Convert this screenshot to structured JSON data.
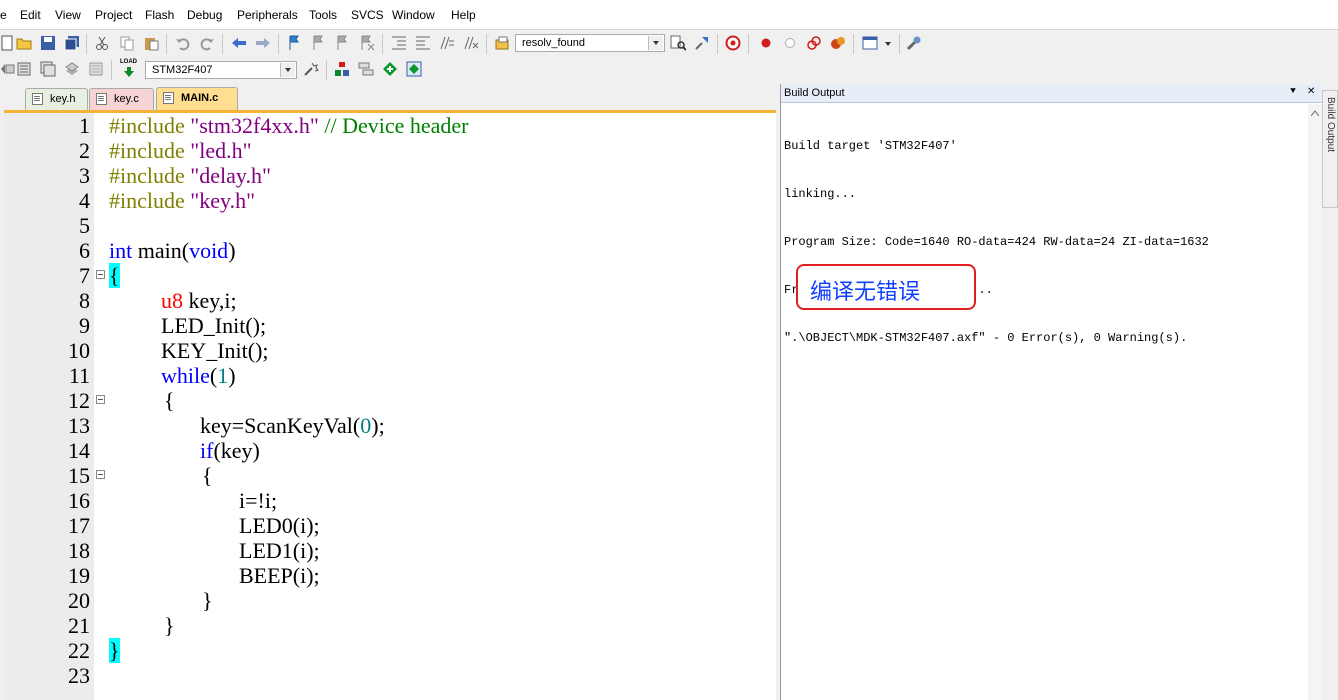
{
  "menu": [
    "e",
    "Edit",
    "View",
    "Project",
    "Flash",
    "Debug",
    "Peripherals",
    "Tools",
    "SVCS",
    "Window",
    "Help"
  ],
  "toolbar": {
    "find_combo": "resolv_found",
    "target_combo": "STM32F407",
    "load_label": "LOAD"
  },
  "tabs": [
    {
      "label": "key.h",
      "active": false,
      "color": "#e6efe0"
    },
    {
      "label": "key.c",
      "active": false,
      "color": "#f7d4d4"
    },
    {
      "label": "MAIN.c",
      "active": true,
      "color": "#ffdf8f"
    }
  ],
  "editor": {
    "line_numbers": [
      "1",
      "2",
      "3",
      "4",
      "5",
      "6",
      "7",
      "8",
      "9",
      "10",
      "11",
      "12",
      "13",
      "14",
      "15",
      "16",
      "17",
      "18",
      "19",
      "20",
      "21",
      "22",
      "23"
    ],
    "l1": {
      "pp": "#include",
      "str": " \"stm32f4xx.h\"",
      "cmt": " // Device header"
    },
    "l2": {
      "pp": "#include",
      "str": " \"led.h\""
    },
    "l3": {
      "pp": "#include",
      "str": " \"delay.h\""
    },
    "l4": {
      "pp": "#include",
      "str": " \"key.h\""
    },
    "l6": {
      "kw1": "int",
      "mid": " main(",
      "kw2": "void",
      "end": ")"
    },
    "l7": "{",
    "l8": {
      "ty": "u8",
      "rest": " key,i;"
    },
    "l9": "LED_Init();",
    "l10": "KEY_Init();",
    "l11": {
      "kw": "while",
      "open": "(",
      "num": "1",
      "close": ")"
    },
    "l12": "{",
    "l13": {
      "pre": "key=ScanKeyVal(",
      "num": "0",
      "post": ");"
    },
    "l14": {
      "kw": "if",
      "rest": "(key)"
    },
    "l15": "{",
    "l16": "i=!i;",
    "l17": "LED0(i);",
    "l18": "LED1(i);",
    "l19": "BEEP(i);",
    "l20": "}",
    "l21": "}",
    "l22": "}"
  },
  "build": {
    "title": "Build Output",
    "lines": [
      "Build target 'STM32F407'",
      "linking...",
      "Program Size: Code=1640 RO-data=424 RW-data=24 ZI-data=1632",
      "FromELF: creating hex file...",
      "\".\\OBJECT\\MDK-STM32F407.axf\" - 0 Error(s), 0 Warning(s)."
    ],
    "annotation": "编译无错误",
    "pin": "⯆",
    "close": "✕",
    "side_tab": "Build Output"
  }
}
